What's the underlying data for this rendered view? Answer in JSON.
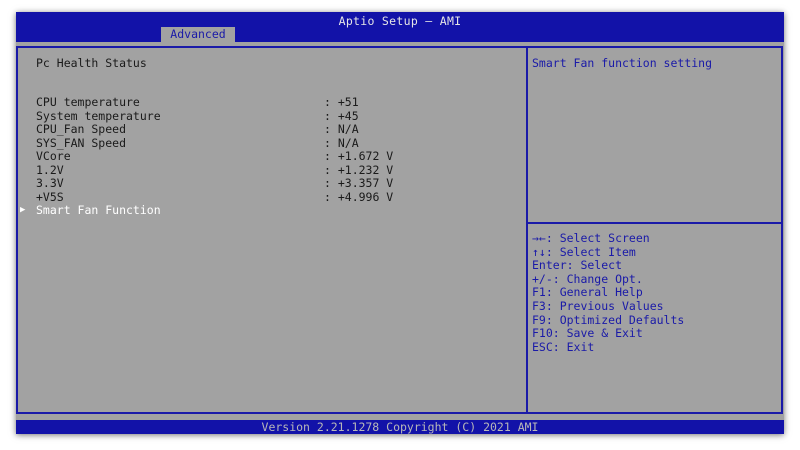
{
  "app_title": "Aptio Setup – AMI",
  "tabs": [
    {
      "label": "Advanced"
    }
  ],
  "main": {
    "heading": "Pc Health Status",
    "rows": [
      {
        "label": "CPU temperature",
        "value": ": +51"
      },
      {
        "label": "System temperature",
        "value": ": +45"
      },
      {
        "label": "CPU_Fan Speed",
        "value": ": N/A"
      },
      {
        "label": "SYS_FAN Speed",
        "value": ": N/A"
      },
      {
        "label": "VCore",
        "value": ": +1.672 V"
      },
      {
        "label": "1.2V",
        "value": ": +1.232 V"
      },
      {
        "label": "3.3V",
        "value": ": +3.357 V"
      },
      {
        "label": "+V5S",
        "value": ": +4.996 V"
      }
    ],
    "submenu": {
      "label": "Smart Fan Function",
      "icon": "right-triangle-icon"
    }
  },
  "help": {
    "description": "Smart Fan function setting",
    "keys": [
      "→←: Select Screen",
      "↑↓: Select Item",
      "Enter: Select",
      "+/-: Change Opt.",
      "F1: General Help",
      "F3: Previous Values",
      "F9: Optimized Defaults",
      "F10: Save & Exit",
      "ESC: Exit"
    ]
  },
  "footer": "Version 2.21.1278 Copyright (C) 2021 AMI",
  "colors": {
    "bios_blue": "#1212a8",
    "panel_gray": "#a2a2a2",
    "highlight_white": "#ffffff"
  }
}
